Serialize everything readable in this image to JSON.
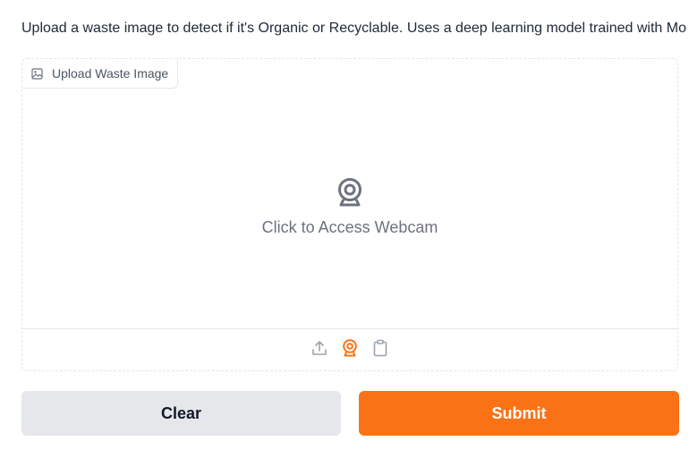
{
  "description": "Upload a waste image to detect if it's Organic or Recyclable. Uses a deep learning model trained with Mo",
  "image_input": {
    "label": "Upload Waste Image",
    "label_icon": "image-icon",
    "webcam_prompt": "Click to Access Webcam",
    "sources": [
      {
        "name": "upload",
        "icon": "upload-icon",
        "active": false
      },
      {
        "name": "webcam",
        "icon": "webcam-icon",
        "active": true
      },
      {
        "name": "clipboard",
        "icon": "clipboard-icon",
        "active": false
      }
    ]
  },
  "buttons": {
    "clear_label": "Clear",
    "submit_label": "Submit"
  },
  "colors": {
    "accent": "#f97316",
    "secondary_button": "#e5e7eb",
    "muted_icon": "#9ca3af",
    "webcam_icon": "#6b7280"
  }
}
